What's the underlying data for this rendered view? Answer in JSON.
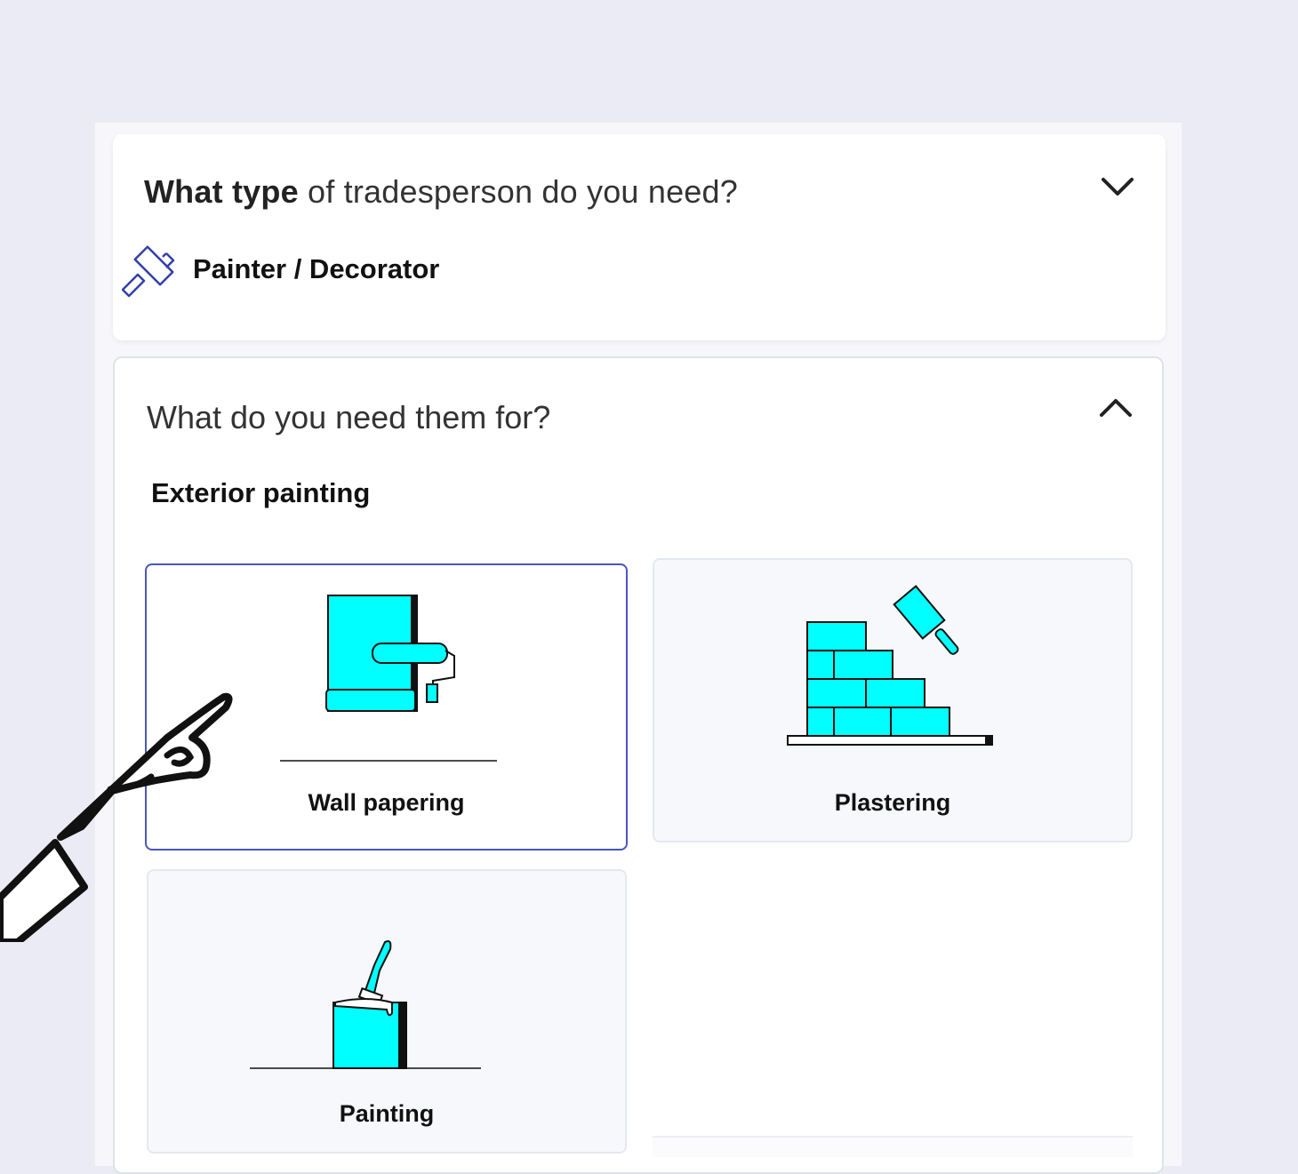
{
  "trade_card": {
    "question_bold": "What type",
    "question_rest": " of tradesperson do you need?",
    "selected_trade": "Painter / Decorator",
    "icon": "paint-roller-icon",
    "toggle_icon": "chevron-down-icon"
  },
  "purpose_card": {
    "question": "What do you need them for?",
    "selected_purpose": "Exterior painting",
    "toggle_icon": "chevron-up-icon",
    "options": [
      {
        "label": "Wall papering",
        "icon": "wallpaper-roll-icon",
        "selected": true
      },
      {
        "label": "Plastering",
        "icon": "brick-wall-trowel-icon",
        "selected": false
      },
      {
        "label": "Painting",
        "icon": "paint-can-brush-icon",
        "selected": false
      }
    ]
  },
  "colors": {
    "background": "#ebebf6",
    "accent_fill": "#00ffff",
    "selected_border": "#4a56c0",
    "icon_blue": "#3340a8"
  }
}
